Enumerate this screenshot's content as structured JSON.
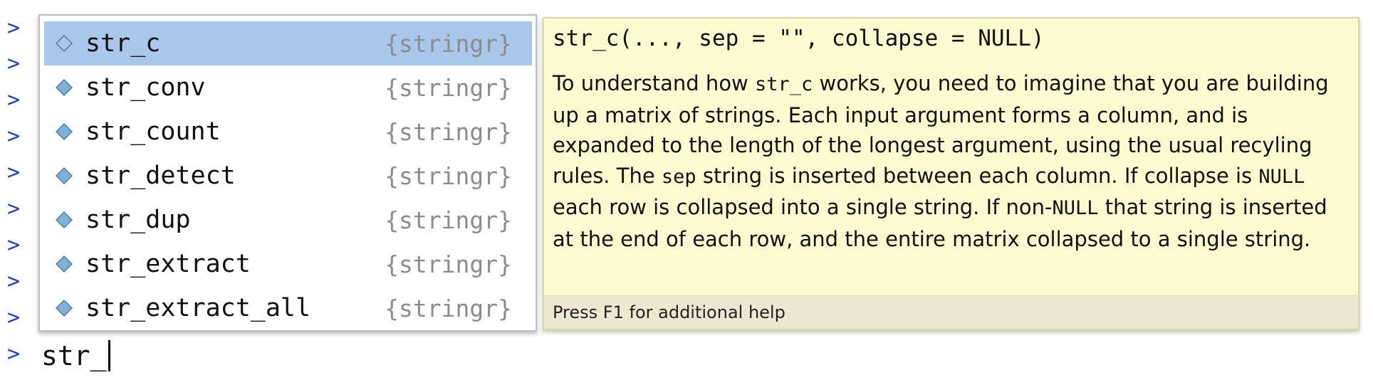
{
  "console": {
    "prompt_symbol": ">",
    "input_text": "str_"
  },
  "completion": {
    "items": [
      {
        "name": "str_c",
        "package": "{stringr}",
        "icon": "function-icon",
        "selected": true
      },
      {
        "name": "str_conv",
        "package": "{stringr}",
        "icon": "function-icon",
        "selected": false
      },
      {
        "name": "str_count",
        "package": "{stringr}",
        "icon": "function-icon",
        "selected": false
      },
      {
        "name": "str_detect",
        "package": "{stringr}",
        "icon": "function-icon",
        "selected": false
      },
      {
        "name": "str_dup",
        "package": "{stringr}",
        "icon": "function-icon",
        "selected": false
      },
      {
        "name": "str_extract",
        "package": "{stringr}",
        "icon": "function-icon",
        "selected": false
      },
      {
        "name": "str_extract_all",
        "package": "{stringr}",
        "icon": "function-icon",
        "selected": false
      }
    ]
  },
  "help": {
    "signature": "str_c(..., sep = \"\", collapse = NULL)",
    "body": [
      {
        "text": "To understand how "
      },
      {
        "text": "str_c",
        "code": true
      },
      {
        "text": " works, you need to imagine that you are building up a matrix of strings. Each input argument forms a column, and is expanded to the length of the longest argument, using the usual recyling rules. The "
      },
      {
        "text": "sep",
        "code": true
      },
      {
        "text": " string is inserted between each column. If collapse is "
      },
      {
        "text": "NULL",
        "code": true
      },
      {
        "text": " each row is collapsed into a single string. If non-"
      },
      {
        "text": "NULL",
        "code": true
      },
      {
        "text": " that string is inserted at the end of each row, and the entire matrix collapsed to a single string."
      }
    ],
    "footer": "Press F1 for additional help"
  },
  "colors": {
    "prompt": "#1f3fd8",
    "selected_row": "#a9c7ea",
    "tooltip_bg": "#fcfbcf",
    "tooltip_footer_bg": "#ebe8cf",
    "package_text": "#8c8c8c",
    "icon_fill": "#7fb1d6"
  }
}
